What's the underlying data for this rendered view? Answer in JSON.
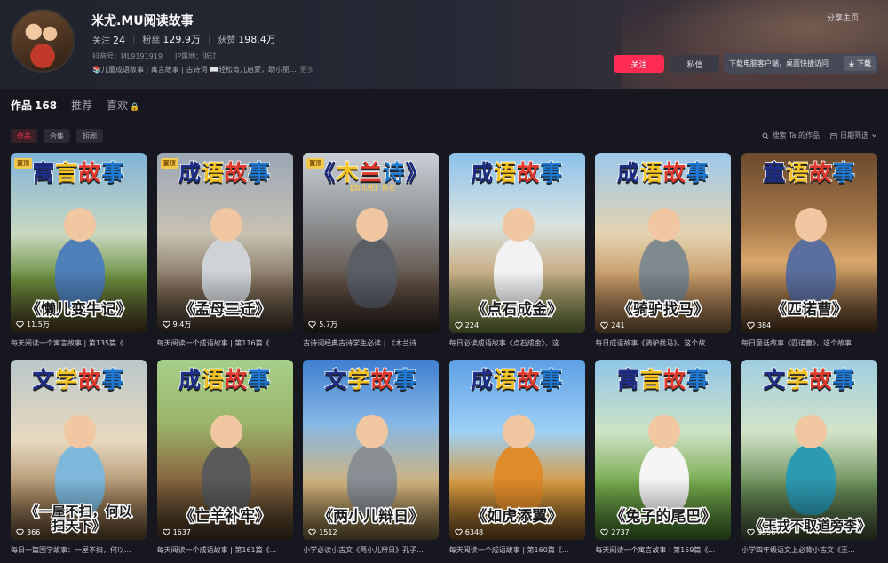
{
  "profile": {
    "name": "米尤.MU阅读故事",
    "following_label": "关注",
    "following": "24",
    "followers_label": "粉丝",
    "followers": "129.9万",
    "likes_label": "获赞",
    "likes": "198.4万",
    "douyin_id": "抖音号：ML9191919",
    "ip": "IP属地：浙江",
    "bio": "📚儿童成语故事 | 寓言故事 | 古诗词 📖轻松育儿启蒙，助小朋...",
    "bio_more": "更多",
    "share_label": "分享主页",
    "follow_btn": "关注",
    "msg_btn": "私信",
    "download_text": "下载电脑客户端，桌面快捷访问",
    "download_btn": "下载"
  },
  "tabs": [
    {
      "label": "作品",
      "count": "168"
    },
    {
      "label": "推荐",
      "count": ""
    },
    {
      "label": "喜欢",
      "count": ""
    }
  ],
  "subtabs": [
    "作品",
    "合集",
    "短剧"
  ],
  "tools": {
    "search": "搜索 Ta 的作品",
    "date_filter": "日期筛选"
  },
  "pin_label": "置顶",
  "videos": [
    {
      "top": "寓言故事",
      "pinned": true,
      "book": "《懒儿变牛记》",
      "likes": "11.5万",
      "desc": "每天阅读一个寓言故事 | 第135篇《..."
    },
    {
      "top": "成语故事",
      "pinned": true,
      "book": "《孟母三迁》",
      "likes": "9.4万",
      "desc": "每天阅读一个成语故事 | 第116篇《..."
    },
    {
      "top": "《木兰诗》",
      "pinned": true,
      "subtitle": "【南北朝】佚名",
      "book": "",
      "likes": "5.7万",
      "desc": "古诗词经典古诗学生必读 | 《木兰诗..."
    },
    {
      "top": "成语故事",
      "pinned": false,
      "book": "《点石成金》",
      "likes": "224",
      "desc": "每日必读成语故事《点石成金》，这..."
    },
    {
      "top": "成语故事",
      "pinned": false,
      "book": "《骑驴找马》",
      "likes": "241",
      "desc": "每日成语故事《骑驴找马》，这个故..."
    },
    {
      "top": "童语故事",
      "pinned": false,
      "book": "《匹诺曹》",
      "likes": "384",
      "desc": "每日童话故事《匹诺曹》，这个故事..."
    },
    {
      "top": "文学故事",
      "pinned": false,
      "book": "《一屋不扫，何以扫天下》",
      "likes": "366",
      "desc": "每日一篇国学故事：一屋不扫，何以..."
    },
    {
      "top": "成语故事",
      "pinned": false,
      "book": "《亡羊补牢》",
      "likes": "1637",
      "desc": "每天阅读一个成语故事 | 第161篇《..."
    },
    {
      "top": "文学故事",
      "pinned": false,
      "book": "《两小儿辩日》",
      "likes": "1512",
      "desc": "小学必读小古文《两小儿辩日》孔子..."
    },
    {
      "top": "成语故事",
      "pinned": false,
      "book": "《如虎添翼》",
      "likes": "6348",
      "desc": "每天阅读一个成语故事 | 第160篇《..."
    },
    {
      "top": "寓言故事",
      "pinned": false,
      "book": "《兔子的尾巴》",
      "likes": "2737",
      "desc": "每天阅读一个寓言故事 | 第159篇《..."
    },
    {
      "top": "文学故事",
      "pinned": false,
      "book": "《王戎不取道旁李》",
      "likes": "3596",
      "desc": "小学四年级语文上必背小古文《王..."
    }
  ],
  "colors": {
    "accent": "#fe2c55",
    "background": "#16171f"
  }
}
